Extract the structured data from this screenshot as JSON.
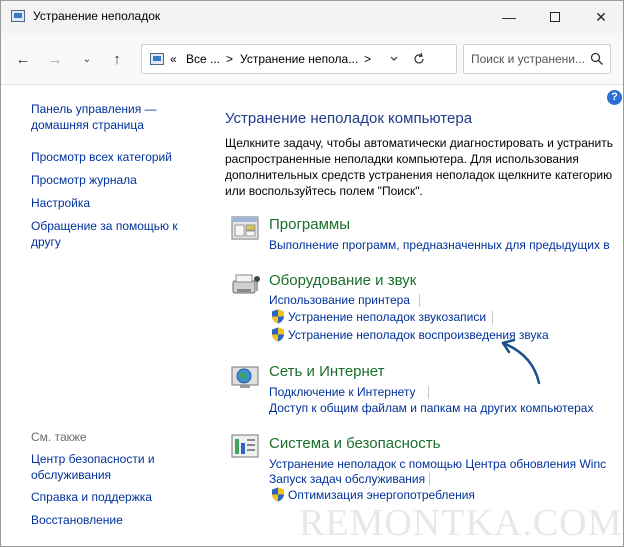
{
  "window": {
    "title": "Устранение неполадок"
  },
  "titlebar": {
    "minimize": "—",
    "close": "✕"
  },
  "nav": {
    "back": "←",
    "forward": "→",
    "recent": "⌄",
    "up": "↑"
  },
  "address": {
    "overflow": "«",
    "segment1": "Все ...",
    "separator": ">",
    "segment2": "Устранение непола...",
    "chevron": ">"
  },
  "search": {
    "placeholder": "Поиск и устранени..."
  },
  "sidebar": {
    "items": [
      {
        "line1": "Панель управления —",
        "line2": "домашняя страница"
      },
      {
        "label": "Просмотр всех категорий"
      },
      {
        "label": "Просмотр журнала"
      },
      {
        "label": "Настройка"
      },
      {
        "line1": "Обращение за помощью к",
        "line2": "другу"
      }
    ],
    "see_also_caption": "См. также",
    "see_also": [
      {
        "line1": "Центр безопасности и",
        "line2": "обслуживания"
      },
      {
        "label": "Справка и поддержка"
      },
      {
        "label": "Восстановление"
      }
    ]
  },
  "help": {
    "label": "?"
  },
  "main": {
    "title": "Устранение неполадок компьютера",
    "description": "Щелкните задачу, чтобы автоматически диагностировать и устранить распространенные неполадки компьютера. Для использования дополнительных средств устранения неполадок щелкните категорию или воспользуйтесь полем \"Поиск\".",
    "categories": [
      {
        "title": "Программы",
        "links": [
          "Выполнение программ, предназначенных для предыдущих в"
        ]
      },
      {
        "title": "Оборудование и звук",
        "links": [
          "Использование принтера",
          "Устранение неполадок звукозаписи",
          "Устранение неполадок воспроизведения звука"
        ]
      },
      {
        "title": "Сеть и Интернет",
        "links": [
          "Подключение к Интернету",
          "Доступ к общим файлам и папкам на других компьютерах"
        ]
      },
      {
        "title": "Система и безопасность",
        "links": [
          "Устранение неполадок с помощью Центра обновления Winc",
          "Запуск задач обслуживания",
          "Оптимизация энергопотребления"
        ]
      }
    ]
  },
  "watermark": "REMONTKA.COM",
  "colors": {
    "link": "#00319c",
    "category": "#1b6e2b",
    "title": "#1e3a8a",
    "arrow": "#1a4f8a"
  }
}
